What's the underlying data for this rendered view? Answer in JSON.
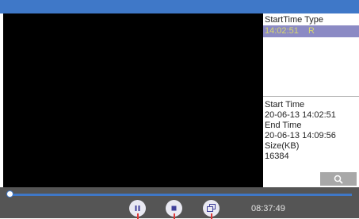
{
  "list": {
    "header": "StartTime Type",
    "rows": [
      {
        "start_time": "14:02:51",
        "type": "R"
      }
    ]
  },
  "info": {
    "start_label": "Start Time",
    "start_value": "20-06-13 14:02:51",
    "end_label": "End Time",
    "end_value": "20-06-13 14:09:56",
    "size_label": "Size(KB)",
    "size_value": "16384"
  },
  "playback": {
    "time": "08:37:49",
    "progress": 0.0
  },
  "icons": [
    "search-icon",
    "pause-icon",
    "stop-icon",
    "windows-icon"
  ],
  "colors": {
    "accent": "#3f78c8",
    "selected_row": "#8b8ac4",
    "selected_text": "#d8d86e",
    "control_bar": "#555555"
  }
}
